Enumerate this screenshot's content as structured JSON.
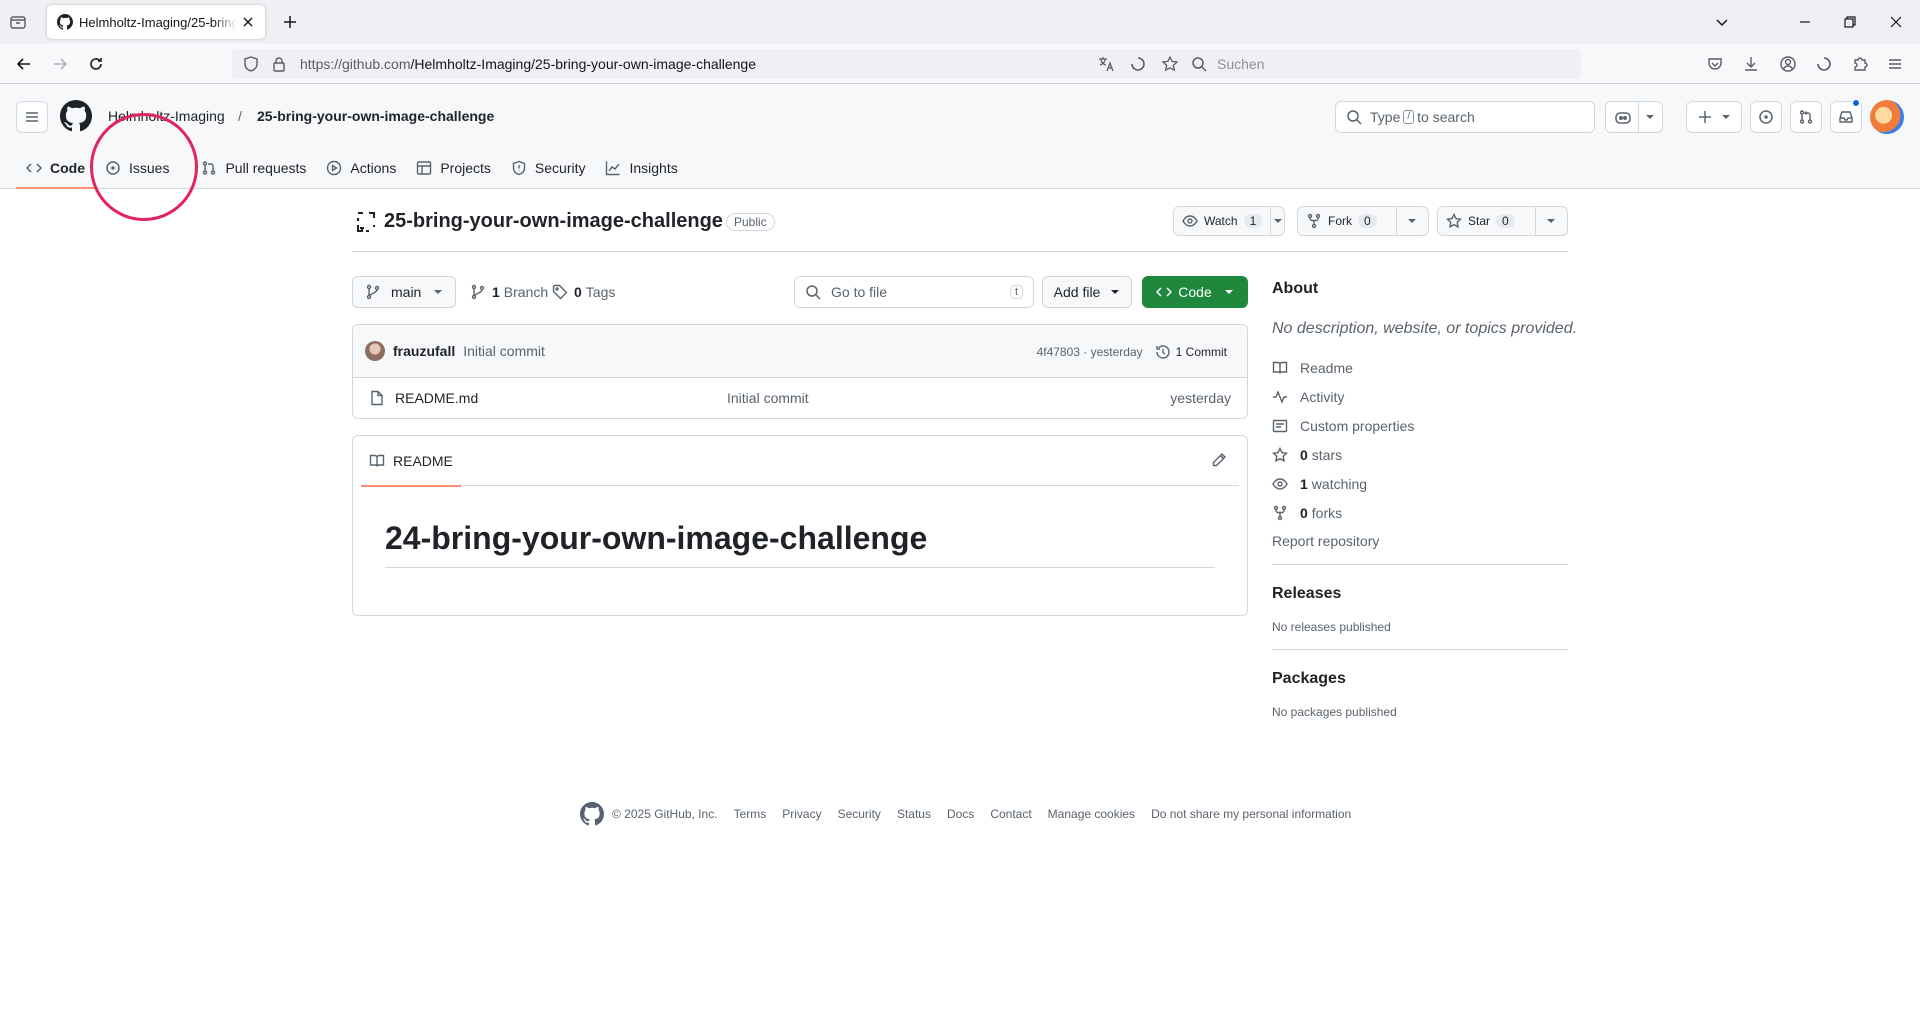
{
  "browser": {
    "tab_title": "Helmholtz-Imaging/25-bring-your-own-image-challenge",
    "url_prefix": "https://github.com",
    "url_path": "/Helmholtz-Imaging/25-bring-your-own-image-challenge",
    "search_placeholder": "Suchen"
  },
  "header": {
    "owner": "Helmholtz-Imaging",
    "separator": "/",
    "repo": "25-bring-your-own-image-challenge",
    "search_prefix": "Type",
    "search_key": "/",
    "search_suffix": "to search"
  },
  "repo_tabs": [
    {
      "label": "Code",
      "icon": "code-icon"
    },
    {
      "label": "Issues",
      "icon": "issue-icon"
    },
    {
      "label": "Pull requests",
      "icon": "pull-request-icon"
    },
    {
      "label": "Actions",
      "icon": "play-icon"
    },
    {
      "label": "Projects",
      "icon": "table-icon"
    },
    {
      "label": "Security",
      "icon": "shield-icon"
    },
    {
      "label": "Insights",
      "icon": "graph-icon"
    }
  ],
  "repo": {
    "name": "25-bring-your-own-image-challenge",
    "visibility": "Public",
    "watch_label": "Watch",
    "watch_count": "1",
    "fork_label": "Fork",
    "fork_count": "0",
    "star_label": "Star",
    "star_count": "0"
  },
  "files": {
    "branch": "main",
    "branch_count": "1",
    "branch_label": "Branch",
    "tag_count": "0",
    "tag_label": "Tags",
    "goto_placeholder": "Go to file",
    "goto_key": "t",
    "add_file": "Add file",
    "code_button": "Code",
    "commit_author": "frauzufall",
    "commit_message": "Initial commit",
    "commit_hash_time": "4f47803 · yesterday",
    "commit_count": "1 Commit",
    "rows": [
      {
        "name": "README.md",
        "message": "Initial commit",
        "date": "yesterday"
      }
    ]
  },
  "readme": {
    "tab_label": "README",
    "heading": "24-bring-your-own-image-challenge"
  },
  "about": {
    "title": "About",
    "description": "No description, website, or topics provided.",
    "readme": "Readme",
    "activity": "Activity",
    "custom_properties": "Custom properties",
    "stars_count": "0",
    "stars_label": "stars",
    "watching_count": "1",
    "watching_label": "watching",
    "forks_count": "0",
    "forks_label": "forks",
    "report": "Report repository",
    "releases_title": "Releases",
    "releases_text": "No releases published",
    "packages_title": "Packages",
    "packages_text": "No packages published"
  },
  "footer": {
    "copyright": "© 2025 GitHub, Inc.",
    "links": [
      "Terms",
      "Privacy",
      "Security",
      "Status",
      "Docs",
      "Contact",
      "Manage cookies",
      "Do not share my personal information"
    ]
  },
  "colors": {
    "accent_underline": "#fd8c73",
    "code_button": "#1f883d",
    "annotation": "#e0245e"
  }
}
